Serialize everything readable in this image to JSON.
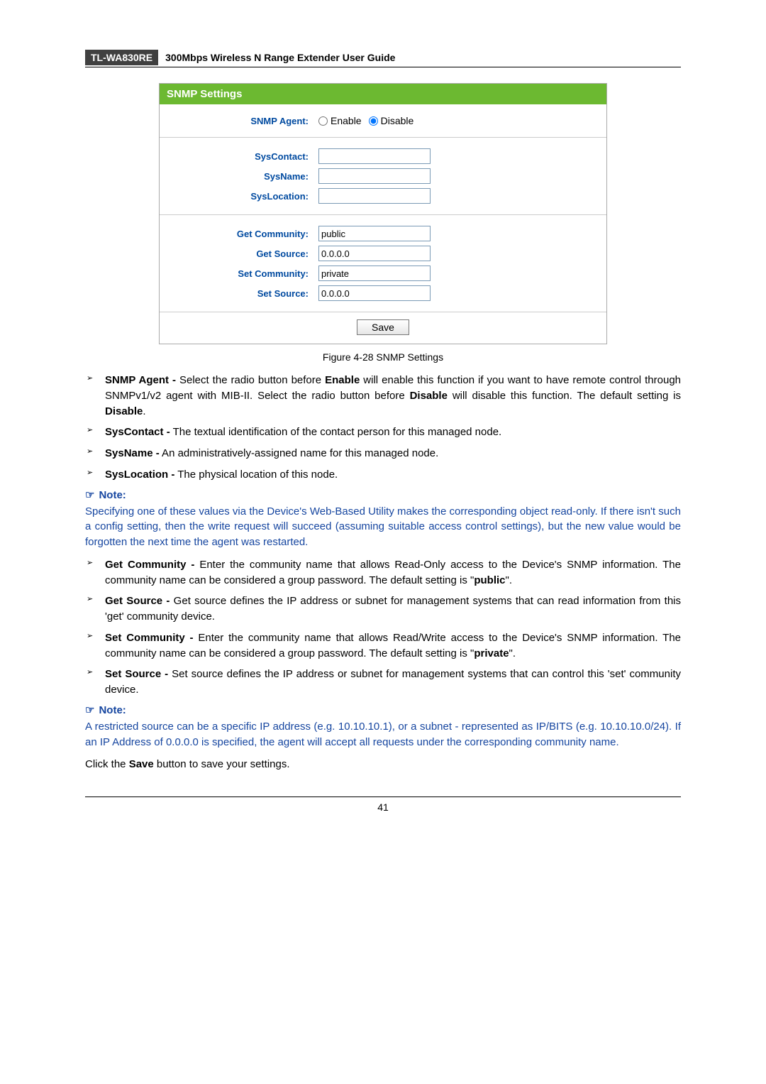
{
  "header": {
    "model": "TL-WA830RE",
    "title": "300Mbps Wireless N Range Extender User Guide"
  },
  "snmp_form": {
    "panel_title": "SNMP Settings",
    "rows": {
      "agent_label": "SNMP Agent:",
      "enable": "Enable",
      "disable": "Disable",
      "syscontact_label": "SysContact:",
      "sysname_label": "SysName:",
      "syslocation_label": "SysLocation:",
      "get_community_label": "Get Community:",
      "get_community_value": "public",
      "get_source_label": "Get Source:",
      "get_source_value": "0.0.0.0",
      "set_community_label": "Set Community:",
      "set_community_value": "private",
      "set_source_label": "Set Source:",
      "set_source_value": "0.0.0.0"
    },
    "save": "Save"
  },
  "figure_caption": "Figure 4-28 SNMP Settings",
  "bullets1": {
    "b1_strong": "SNMP Agent -",
    "b1_text_a": " Select the radio button before ",
    "b1_strong2": "Enable",
    "b1_text_b": " will enable this function if you want to have remote control through SNMPv1/v2 agent with MIB-II. Select the radio button before ",
    "b1_strong3": "Disable",
    "b1_text_c": " will disable this function. The default setting is ",
    "b1_strong4": "Disable",
    "b1_text_d": ".",
    "b2_strong": "SysContact -",
    "b2_text": " The textual identification of the contact person for this managed node.",
    "b3_strong": "SysName -",
    "b3_text": " An administratively-assigned name for this managed node.",
    "b4_strong": "SysLocation -",
    "b4_text": " The physical location of this node."
  },
  "note1": {
    "label": "Note:",
    "body": "Specifying one of these values via the Device's Web-Based Utility makes the corresponding object read-only. If there isn't such a config setting, then the write request will succeed (assuming suitable access control settings), but the new value would be forgotten the next time the agent was restarted."
  },
  "bullets2": {
    "b1_strong": "Get Community -",
    "b1_text_a": " Enter the community name that allows Read-Only access to the Device's SNMP information. The community name can be considered a group password. The default setting is \"",
    "b1_strong2": "public",
    "b1_text_b": "\".",
    "b2_strong": "Get Source -",
    "b2_text": " Get source defines the IP address or subnet for management systems that can read information from this 'get' community device.",
    "b3_strong": "Set Community -",
    "b3_text_a": " Enter the community name that allows Read/Write access to the Device's SNMP information. The community name can be considered a group password. The default setting is \"",
    "b3_strong2": "private",
    "b3_text_b": "\".",
    "b4_strong": "Set Source -",
    "b4_text": " Set source defines the IP address or subnet for management systems that can control this 'set' community device."
  },
  "note2": {
    "label": "Note:",
    "body": "A restricted source can be a specific IP address (e.g. 10.10.10.1), or a subnet - represented as IP/BITS (e.g. 10.10.10.0/24). If an IP Address of 0.0.0.0 is specified, the agent will accept all requests under the corresponding community name."
  },
  "closing": {
    "a": "Click the ",
    "b": "Save",
    "c": " button to save your settings."
  },
  "page_number": "41"
}
